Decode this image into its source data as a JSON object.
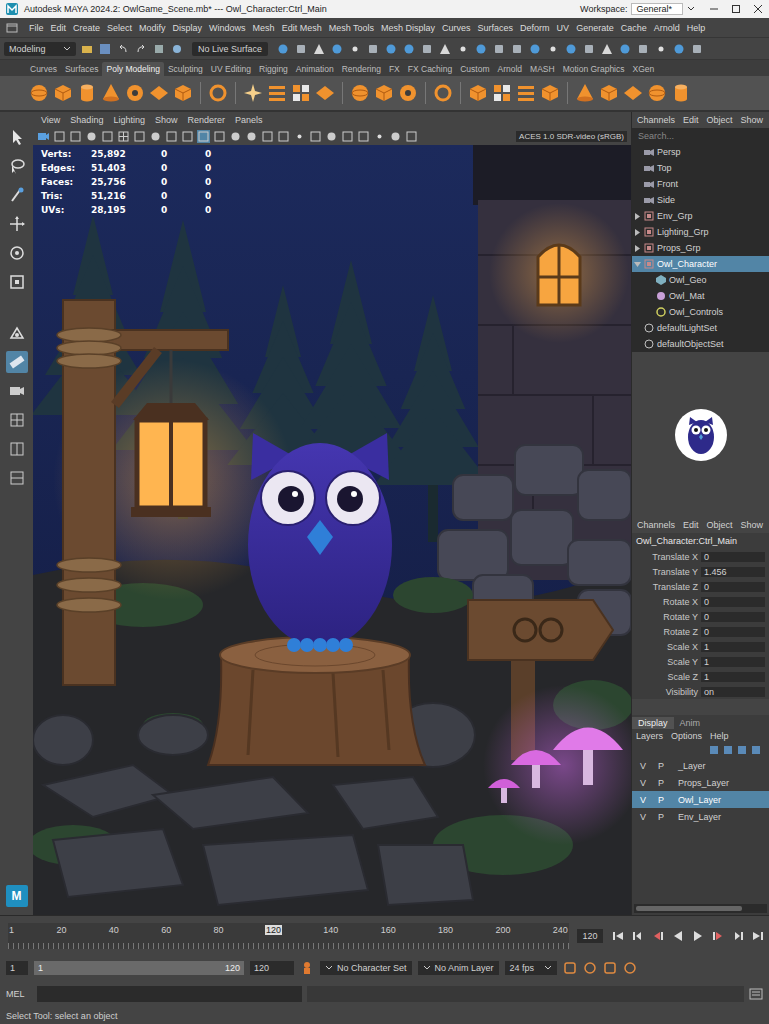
{
  "window": {
    "title": "Autodesk MAYA 2024.2: OwlGame_Scene.mb* --- Owl_Character:Ctrl_Main",
    "workspace_label": "Workspace:",
    "workspace": "General*"
  },
  "menu": [
    "File",
    "Edit",
    "Create",
    "Select",
    "Modify",
    "Display",
    "Windows",
    "Mesh",
    "Edit Mesh",
    "Mesh Tools",
    "Mesh Display",
    "Curves",
    "Surfaces",
    "Deform",
    "UV",
    "Generate",
    "Cache",
    "Arnold",
    "Help"
  ],
  "status_line": {
    "mode": "Modeling",
    "live_surface": "No Live Surface"
  },
  "shelf_tabs": [
    {
      "label": "Curves",
      "selected": false
    },
    {
      "label": "Surfaces",
      "selected": false
    },
    {
      "label": "Poly Modeling",
      "selected": true
    },
    {
      "label": "Sculpting",
      "selected": false
    },
    {
      "label": "UV Editing",
      "selected": false
    },
    {
      "label": "Rigging",
      "selected": false
    },
    {
      "label": "Animation",
      "selected": false
    },
    {
      "label": "Rendering",
      "selected": false
    },
    {
      "label": "FX",
      "selected": false
    },
    {
      "label": "FX Caching",
      "selected": false
    },
    {
      "label": "Custom",
      "selected": false
    },
    {
      "label": "Arnold",
      "selected": false
    },
    {
      "label": "MASH",
      "selected": false
    },
    {
      "label": "Motion Graphics",
      "selected": false
    },
    {
      "label": "XGen",
      "selected": false
    }
  ],
  "toolbox": {
    "logo": "M",
    "tools": [
      {
        "selected": false
      },
      {
        "selected": false
      },
      {
        "selected": false
      },
      {
        "selected": false
      },
      {
        "selected": false
      },
      {
        "selected": false
      },
      {
        "selected": false
      },
      {
        "selected": true
      },
      {
        "selected": false
      },
      {
        "selected": false
      },
      {
        "selected": false
      },
      {
        "selected": false
      }
    ]
  },
  "viewport": {
    "menu": [
      "View",
      "Shading",
      "Lighting",
      "Show",
      "Renderer",
      "Panels"
    ],
    "color_space": "ACES 1.0 SDR-video (sRGB)",
    "hud": [
      {
        "label": "Verts:",
        "values": [
          "25,892",
          "0",
          "0"
        ]
      },
      {
        "label": "Edges:",
        "values": [
          "51,403",
          "0",
          "0"
        ]
      },
      {
        "label": "Faces:",
        "values": [
          "25,756",
          "0",
          "0"
        ]
      },
      {
        "label": "Tris:",
        "values": [
          "51,216",
          "0",
          "0"
        ]
      },
      {
        "label": "UVs:",
        "values": [
          "28,195",
          "0",
          "0"
        ]
      }
    ]
  },
  "outliner": {
    "menu": [
      "Channels",
      "Edit",
      "Object",
      "Show"
    ],
    "search_placeholder": "Search...",
    "items": [
      {
        "label": "Persp",
        "kind": "camera",
        "depth": 0,
        "expanded": false,
        "selected": false
      },
      {
        "label": "Top",
        "kind": "camera",
        "depth": 0,
        "expanded": false,
        "selected": false
      },
      {
        "label": "Front",
        "kind": "camera",
        "depth": 0,
        "expanded": false,
        "selected": false
      },
      {
        "label": "Side",
        "kind": "camera",
        "depth": 0,
        "expanded": false,
        "selected": false
      },
      {
        "label": "Env_Grp",
        "kind": "group",
        "depth": 0,
        "expanded": false,
        "selected": false
      },
      {
        "label": "Lighting_Grp",
        "kind": "group",
        "depth": 0,
        "expanded": false,
        "selected": false
      },
      {
        "label": "Props_Grp",
        "kind": "group",
        "depth": 0,
        "expanded": false,
        "selected": false
      },
      {
        "label": "Owl_Character",
        "kind": "group",
        "depth": 0,
        "expanded": true,
        "selected": true
      },
      {
        "label": "Owl_Geo",
        "kind": "mesh",
        "depth": 1,
        "expanded": false,
        "selected": false
      },
      {
        "label": "Owl_Mat",
        "kind": "material",
        "depth": 1,
        "expanded": false,
        "selected": false
      },
      {
        "label": "Owl_Controls",
        "kind": "controls",
        "depth": 1,
        "expanded": false,
        "selected": false
      },
      {
        "label": "defaultLightSet",
        "kind": "set",
        "depth": 0,
        "expanded": false,
        "selected": false
      },
      {
        "label": "defaultObjectSet",
        "kind": "set",
        "depth": 0,
        "expanded": false,
        "selected": false
      }
    ]
  },
  "channel_box": {
    "menu": [
      "Channels",
      "Edit",
      "Object",
      "Show"
    ],
    "object": "Owl_Character:Ctrl_Main",
    "attributes": [
      {
        "name": "Translate X",
        "value": "0"
      },
      {
        "name": "Translate Y",
        "value": "1.456"
      },
      {
        "name": "Translate Z",
        "value": "0"
      },
      {
        "name": "Rotate X",
        "value": "0"
      },
      {
        "name": "Rotate Y",
        "value": "0"
      },
      {
        "name": "Rotate Z",
        "value": "0"
      },
      {
        "name": "Scale X",
        "value": "1"
      },
      {
        "name": "Scale Y",
        "value": "1"
      },
      {
        "name": "Scale Z",
        "value": "1"
      },
      {
        "name": "Visibility",
        "value": "on"
      }
    ]
  },
  "layers": {
    "tabs": [
      {
        "label": "Display",
        "selected": true
      },
      {
        "label": "Anim",
        "selected": false
      }
    ],
    "menu": [
      "Layers",
      "Options",
      "Help"
    ],
    "rows": [
      {
        "visible": "V",
        "playback": "P",
        "name": "_Layer",
        "selected": false
      },
      {
        "visible": "V",
        "playback": "P",
        "name": "Props_Layer",
        "selected": false
      },
      {
        "visible": "V",
        "playback": "P",
        "name": "Owl_Layer",
        "selected": true
      },
      {
        "visible": "V",
        "playback": "P",
        "name": "Env_Layer",
        "selected": false
      }
    ]
  },
  "timeline": {
    "ticks": [
      {
        "label": "1",
        "selected": false
      },
      {
        "label": "20",
        "selected": false
      },
      {
        "label": "40",
        "selected": false
      },
      {
        "label": "60",
        "selected": false
      },
      {
        "label": "80",
        "selected": false
      },
      {
        "label": "120",
        "selected": true
      },
      {
        "label": "140",
        "selected": false
      },
      {
        "label": "160",
        "selected": false
      },
      {
        "label": "180",
        "selected": false
      },
      {
        "label": "200",
        "selected": false
      },
      {
        "label": "240",
        "selected": false
      }
    ],
    "current_frame": "120"
  },
  "range": {
    "anim_start": "1",
    "play_start": "1",
    "play_end": "120",
    "anim_end": "120",
    "level": 1,
    "character_set": "No Character Set",
    "anim_layer": "No Anim Layer",
    "fps": "24 fps"
  },
  "command_line": {
    "language": "MEL"
  },
  "help_line": "Select Tool: select an object"
}
